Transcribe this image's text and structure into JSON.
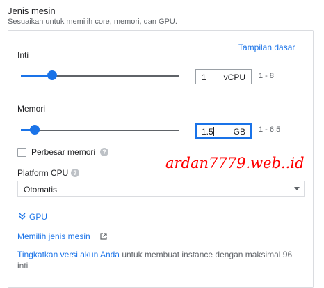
{
  "header": {
    "title": "Jenis mesin",
    "subtitle": "Sesuaikan untuk memilih core, memori, dan GPU."
  },
  "basic_view_link": "Tampilan dasar",
  "cores": {
    "label": "Inti",
    "value": "1",
    "unit": "vCPU",
    "range": "1 - 8",
    "slider_fraction": 0.2
  },
  "memory": {
    "label": "Memori",
    "value": "1.5",
    "unit": "GB",
    "range": "1 - 6.5",
    "slider_fraction": 0.09
  },
  "extend_memory": {
    "label": "Perbesar memori",
    "checked": false
  },
  "cpu_platform": {
    "label": "Platform CPU",
    "selected": "Otomatis"
  },
  "gpu_toggle": "GPU",
  "choose_machine_link": "Memilih jenis mesin",
  "upgrade": {
    "link": "Tingkatkan versi akun Anda",
    "text": " untuk membuat instance dengan maksimal 96",
    "text2": "inti"
  },
  "watermark": "ardan7779.web..id",
  "colors": {
    "accent": "#1a73e8",
    "watermark": "#ff0000"
  },
  "icons": {
    "help": "help-circle-icon",
    "gpu_chevron": "chevron-double-down-icon",
    "external": "open-in-new-icon",
    "dropdown": "dropdown-arrow-icon"
  }
}
